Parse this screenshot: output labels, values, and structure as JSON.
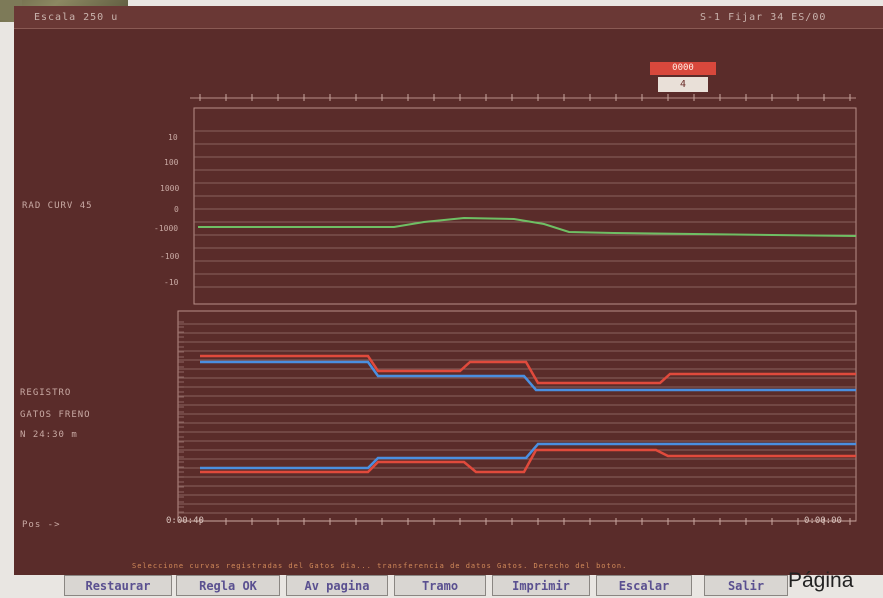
{
  "screen": {
    "topbar": {
      "left_text": "Escala   250 u",
      "right_text": "S-1 Fijar   34 ES/00"
    },
    "badge": {
      "top_text": "0000",
      "bottom_text": "4"
    },
    "upper_panel_label": "RAD CURV 45",
    "upper_ticks": [
      "10",
      "100",
      "1000",
      "0",
      "-1000",
      "-100",
      "-10"
    ],
    "lower_panel_label_lines": [
      "REGISTRO",
      "GATOS FRENO",
      "N  24:30 m"
    ],
    "corner_label": "Pos  ->",
    "time_start": "0:00:40",
    "time_end": "0:00:00",
    "status_line": "Seleccione curvas registradas del Gatos dia... transferencia de datos Gatos. Derecho del boton.",
    "colors": {
      "background": "#5a2c2a",
      "grid": "#a58080",
      "green": "#6fbf64",
      "red": "#e04a3c",
      "blue": "#4a8fe0"
    }
  },
  "buttons": [
    {
      "label": "Restaurar"
    },
    {
      "label": "Regla  OK"
    },
    {
      "label": "Av pagina"
    },
    {
      "label": "Tramo"
    },
    {
      "label": "Imprimir"
    },
    {
      "label": "Escalar"
    },
    {
      "label": "Salir"
    }
  ],
  "page_footer": "Página"
}
